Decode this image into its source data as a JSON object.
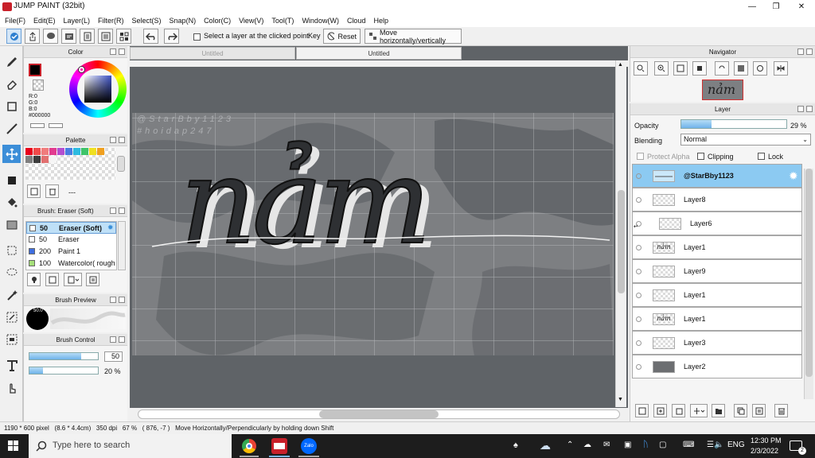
{
  "window": {
    "title": "JUMP PAINT (32bit)"
  },
  "menu": [
    "File(F)",
    "Edit(E)",
    "Layer(L)",
    "Filter(R)",
    "Select(S)",
    "Snap(N)",
    "Color(C)",
    "View(V)",
    "Tool(T)",
    "Window(W)",
    "Cloud",
    "Help"
  ],
  "toolbar": {
    "select_layer_label": "Select a layer at the clicked point",
    "key_label": "Key",
    "reset_label": "Reset",
    "move_label": "Move horizontally/vertically"
  },
  "color_panel": {
    "title": "Color",
    "r": "R:0",
    "g": "G:0",
    "b": "B:0",
    "hex": "#000000",
    "primary_color": "#000000",
    "accent": "#c8202a"
  },
  "palette_panel": {
    "title": "Palette",
    "colors": [
      "#e8001c",
      "#f04a4a",
      "#f07c7c",
      "#e23b8f",
      "#b44fd0",
      "#4a7de2",
      "#2dbbe0",
      "#3fc46a",
      "#f0e020",
      "#f0a020",
      "#7f7f7f",
      "#3c3c3c",
      "#e27070",
      "#f5f5f5"
    ],
    "dash": "---"
  },
  "brush_panel": {
    "title": "Brush: Eraser (Soft)",
    "items": [
      {
        "size": "50",
        "name": "Eraser (Soft)",
        "color": "#ffffff",
        "selected": true
      },
      {
        "size": "50",
        "name": "Eraser",
        "color": "#ffffff",
        "selected": false
      },
      {
        "size": "200",
        "name": "Paint 1",
        "color": "#3f6fe0",
        "selected": false
      },
      {
        "size": "100",
        "name": "Watercolor( rough",
        "color": "#a6e07a",
        "selected": false
      }
    ]
  },
  "brush_preview": {
    "title": "Brush Preview",
    "size_label": "50.0"
  },
  "brush_control": {
    "title": "Brush Control",
    "size_value": "50",
    "opacity_value": "20 %",
    "size_fraction": 0.75,
    "opacity_fraction": 0.2
  },
  "canvas": {
    "tabs": [
      "Untitled",
      "Untitled"
    ],
    "watermark": [
      "@StarBby1123",
      "#hoidap247"
    ],
    "artwork_text": "nảm"
  },
  "navigator": {
    "title": "Navigator"
  },
  "layer_panel": {
    "title": "Layer",
    "opacity_label": "Opacity",
    "opacity_value": "29 %",
    "opacity_fraction": 0.29,
    "blending_label": "Blending",
    "blending_value": "Normal",
    "protect_alpha_label": "Protect Alpha",
    "clipping_label": "Clipping",
    "lock_label": "Lock",
    "layers": [
      {
        "name": "@StarBby1123",
        "selected": true,
        "thumb": "line"
      },
      {
        "name": "Layer8",
        "selected": false,
        "thumb": "blank"
      },
      {
        "name": "Layer6",
        "selected": false,
        "thumb": "blank",
        "indented": true
      },
      {
        "name": "Layer1",
        "selected": false,
        "thumb": "art"
      },
      {
        "name": "Layer9",
        "selected": false,
        "thumb": "blank"
      },
      {
        "name": "Layer1",
        "selected": false,
        "thumb": "blank"
      },
      {
        "name": "Layer1",
        "selected": false,
        "thumb": "art"
      },
      {
        "name": "Layer3",
        "selected": false,
        "thumb": "blank"
      },
      {
        "name": "Layer2",
        "selected": false,
        "thumb": "dark"
      }
    ]
  },
  "statusbar": {
    "text": "1190 * 600 pixel   (8.6 * 4.4cm)   350 dpi   67 %   ( 876, -7 )   Move Horizontally/Perpendicularly by holding down Shift"
  },
  "taskbar": {
    "search_placeholder": "Type here to search",
    "language": "ENG",
    "time": "12:30 PM",
    "date": "2/3/2022",
    "notification_count": "2",
    "zalo_label": "Zalo"
  }
}
